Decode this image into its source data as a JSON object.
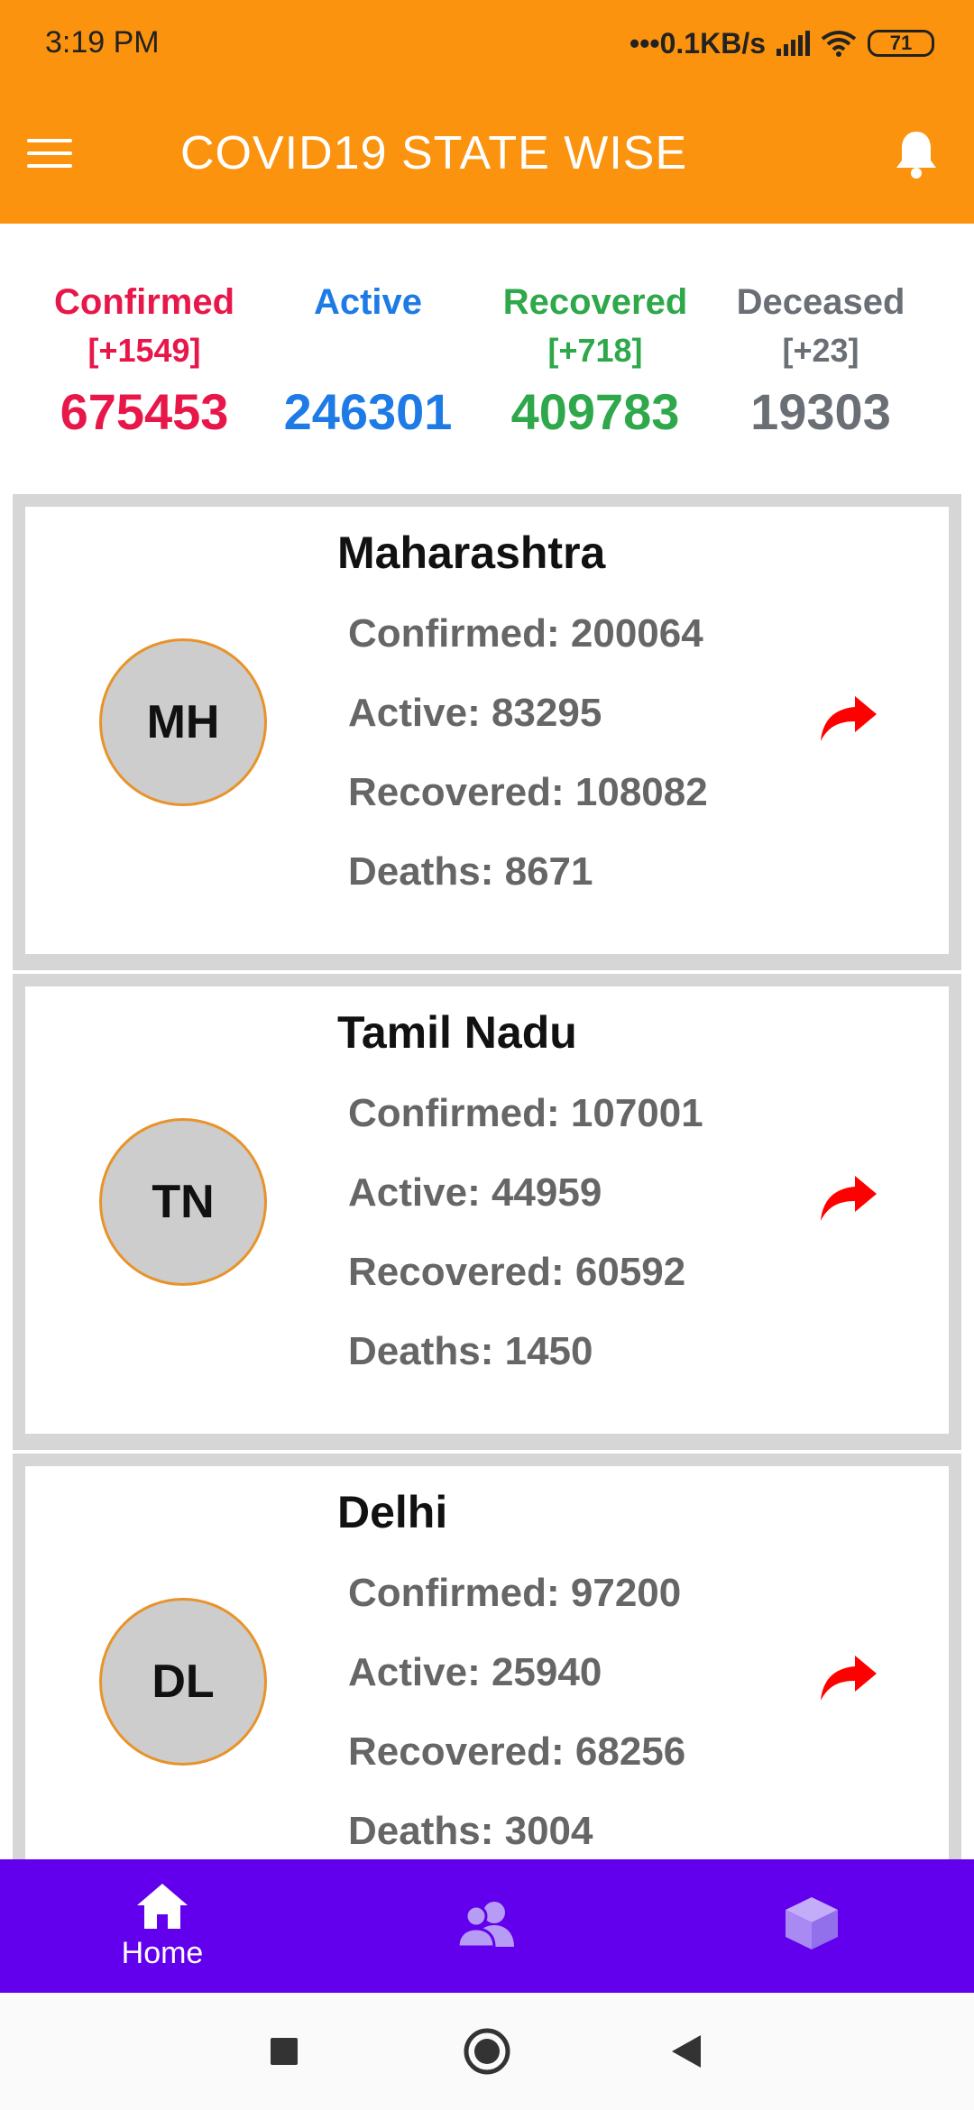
{
  "status_bar": {
    "time": "3:19 PM",
    "network_speed": "•••0.1KB/s",
    "battery": "71"
  },
  "app_bar": {
    "title": "COVID19 STATE WISE"
  },
  "summary": [
    {
      "label": "Confirmed",
      "delta": "[+1549]",
      "value": "675453",
      "color": "#E8174A"
    },
    {
      "label": "Active",
      "delta": "",
      "value": "246301",
      "color": "#1E7BE6"
    },
    {
      "label": "Recovered",
      "delta": "[+718]",
      "value": "409783",
      "color": "#2EA84A"
    },
    {
      "label": "Deceased",
      "delta": "[+23]",
      "value": "19303",
      "color": "#6A6F76"
    }
  ],
  "states": [
    {
      "code": "MH",
      "name": "Maharashtra",
      "confirmed": "Confirmed: 200064",
      "active": "Active: 83295",
      "recovered": "Recovered: 108082",
      "deaths": "Deaths: 8671"
    },
    {
      "code": "TN",
      "name": "Tamil Nadu",
      "confirmed": "Confirmed: 107001",
      "active": "Active: 44959",
      "recovered": "Recovered: 60592",
      "deaths": "Deaths: 1450"
    },
    {
      "code": "DL",
      "name": "Delhi",
      "confirmed": "Confirmed: 97200",
      "active": "Active: 25940",
      "recovered": "Recovered: 68256",
      "deaths": "Deaths: 3004"
    }
  ],
  "bottom_nav": [
    {
      "label": "Home",
      "icon": "home-icon",
      "active": true
    },
    {
      "label": "",
      "icon": "people-icon",
      "active": false
    },
    {
      "label": "",
      "icon": "cube-icon",
      "active": false
    }
  ],
  "colors": {
    "app_bar": "#FB930E",
    "bottom_nav": "#6200EE",
    "share_icon": "#FF0000",
    "avatar_border": "#E8932A"
  }
}
